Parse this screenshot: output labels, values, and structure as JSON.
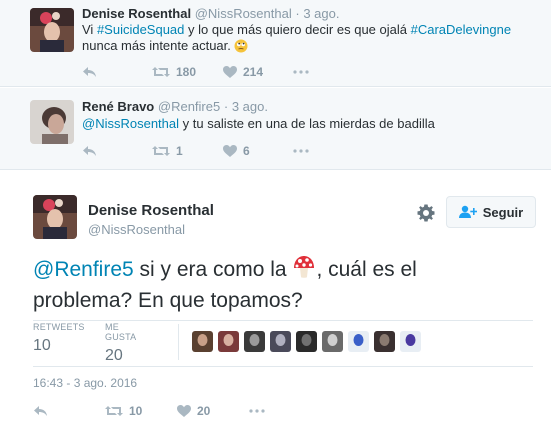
{
  "tweets": [
    {
      "fullname": "Denise Rosenthal",
      "handle": "@NissRosenthal",
      "time": "3 ago.",
      "text_parts": [
        "Vi ",
        "#SuicideSquad",
        " y lo que más quiero decir es que ojalá ",
        "#CaraDelevingne",
        " nunca más intente actuar. "
      ],
      "emoji": "rolling-eyes-emoji",
      "retweets": "180",
      "likes": "214"
    },
    {
      "fullname": "René Bravo",
      "handle": "@Renfire5",
      "time": "3 ago.",
      "text_parts": [
        "@NissRosenthal",
        " y tu saliste en una de las mierdas de badilla"
      ],
      "retweets": "1",
      "likes": "6"
    }
  ],
  "dot": "·",
  "permalink": {
    "fullname": "Denise Rosenthal",
    "handle": "@NissRosenthal",
    "follow_label": "Seguir",
    "text_mention": "@Renfire5",
    "text_before_emoji": " si y era como la ",
    "emoji": "mushroom-emoji",
    "text_after_emoji": ", cuál es el problema? En que topamos?",
    "retweets_label": "RETWEETS",
    "retweets": "10",
    "likes_label": "ME GUSTA",
    "likes": "20",
    "liker_count": 9,
    "timestamp": "16:43 - 3 ago. 2016",
    "action_retweets": "10",
    "action_likes": "20"
  },
  "icons": [
    "reply-icon",
    "retweet-icon",
    "heart-icon",
    "more-icon",
    "gear-icon",
    "follow-user-icon"
  ],
  "colors": {
    "link": "#0084b4",
    "muted": "#8899a6",
    "icon": "#aab8c2",
    "reply_bg": "#f5f8fa",
    "text": "#292f33"
  }
}
